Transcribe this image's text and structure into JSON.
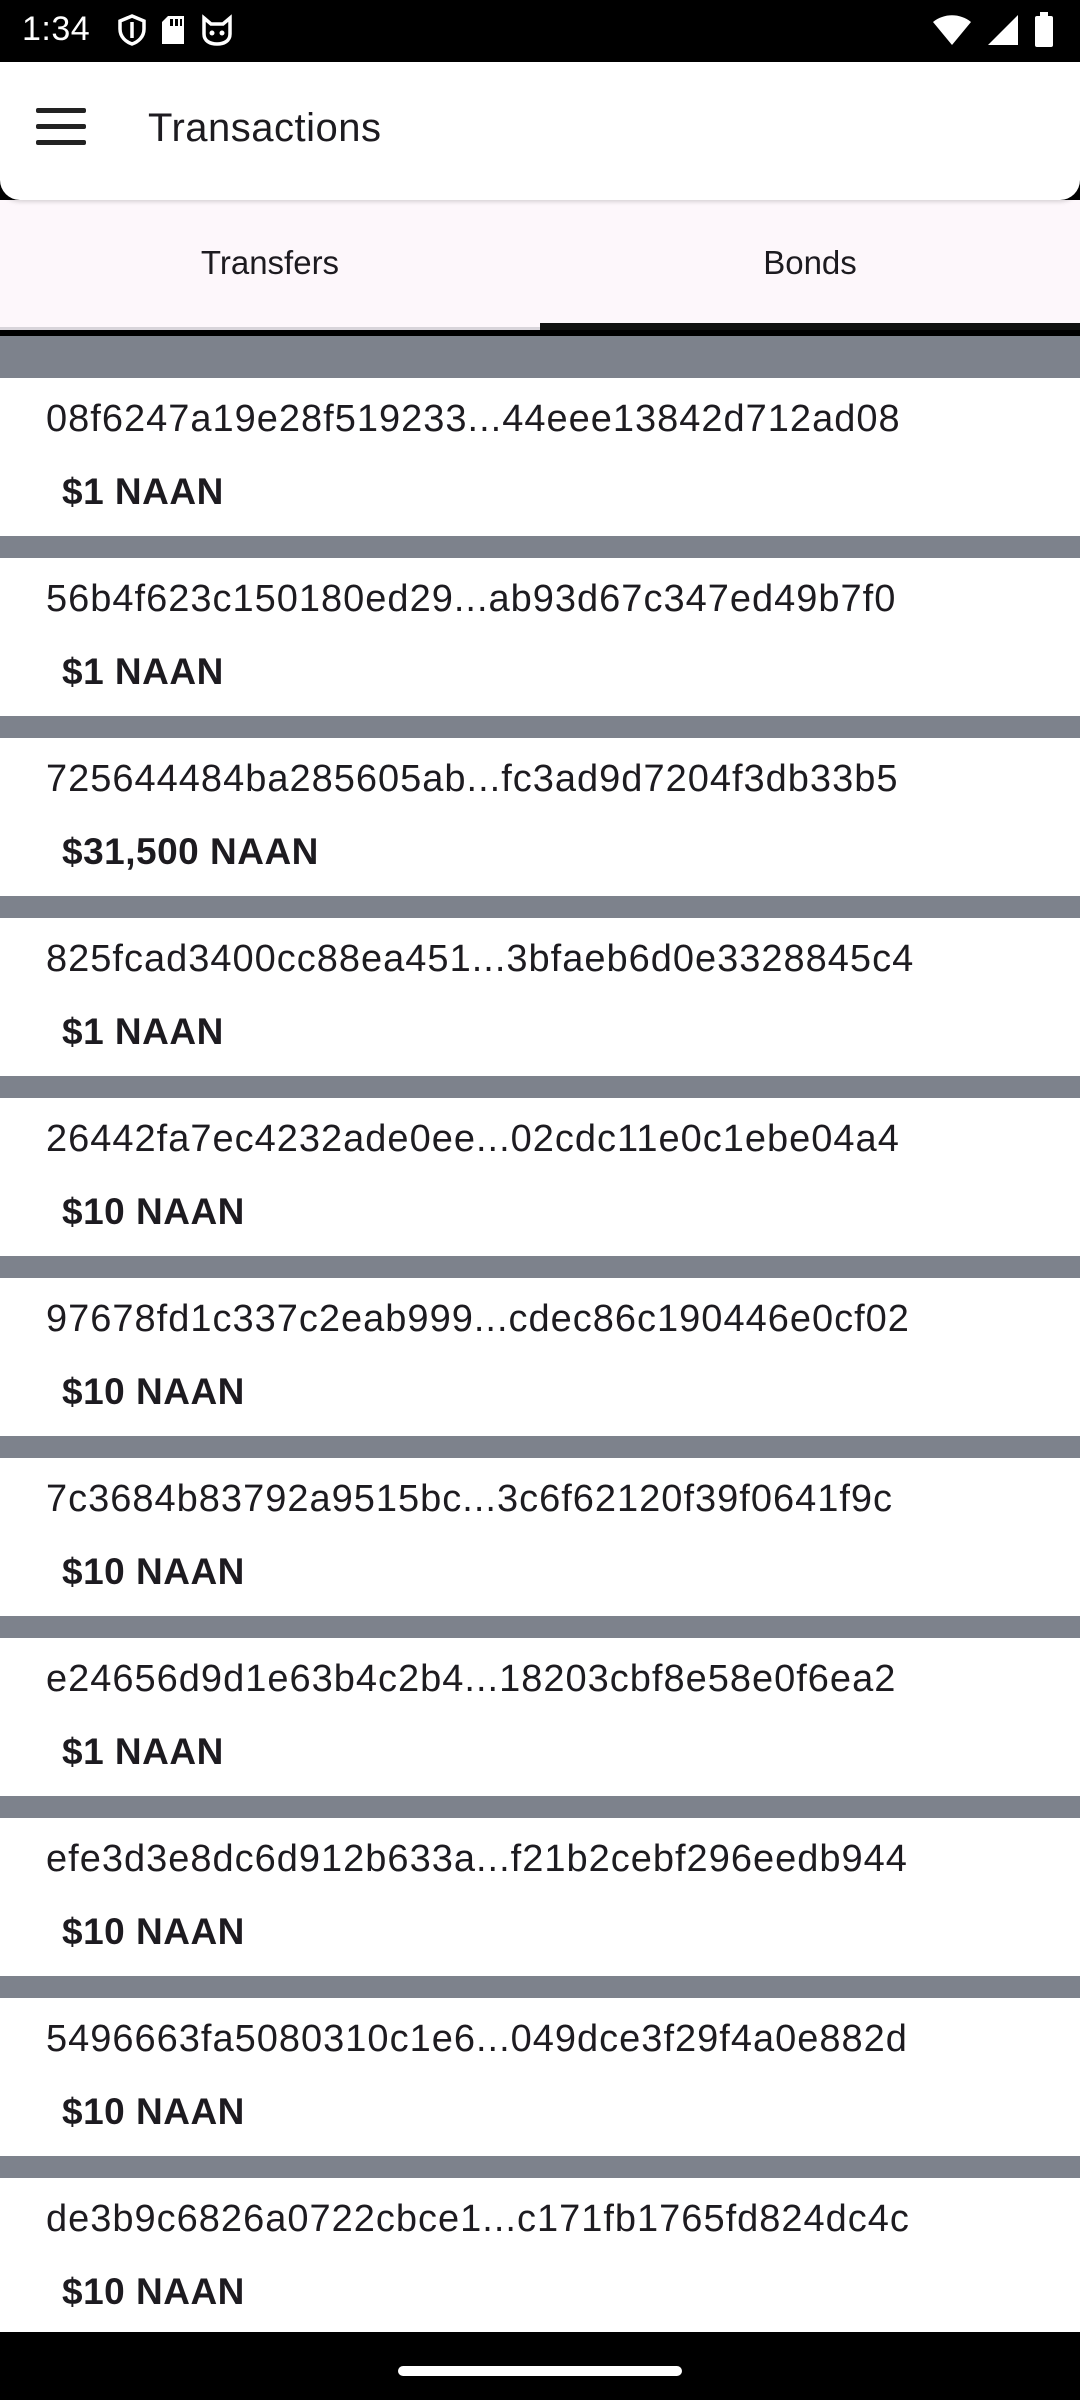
{
  "status_bar": {
    "time": "1:34",
    "left_icons": [
      "shield-icon",
      "sd-card-icon",
      "cat-face-icon"
    ],
    "right_icons": [
      "wifi-icon",
      "signal-icon",
      "battery-icon"
    ]
  },
  "app_bar": {
    "title": "Transactions",
    "menu_icon": "hamburger-menu-icon"
  },
  "tabs": [
    {
      "label": "Transfers",
      "selected": false
    },
    {
      "label": "Bonds",
      "selected": true
    }
  ],
  "bonds": [
    {
      "hash": "08f6247a19e28f519233...44eee13842d712ad08",
      "amount": "$1 NAAN"
    },
    {
      "hash": "56b4f623c150180ed29...ab93d67c347ed49b7f0",
      "amount": "$1 NAAN"
    },
    {
      "hash": "725644484ba285605ab...fc3ad9d7204f3db33b5",
      "amount": "$31,500 NAAN"
    },
    {
      "hash": "825fcad3400cc88ea451...3bfaeb6d0e3328845c4",
      "amount": "$1 NAAN"
    },
    {
      "hash": "26442fa7ec4232ade0ee...02cdc11e0c1ebe04a4",
      "amount": "$10 NAAN"
    },
    {
      "hash": "97678fd1c337c2eab999...cdec86c190446e0cf02",
      "amount": "$10 NAAN"
    },
    {
      "hash": "7c3684b83792a9515bc...3c6f62120f39f0641f9c",
      "amount": "$10 NAAN"
    },
    {
      "hash": "e24656d9d1e63b4c2b4...18203cbf8e58e0f6ea2",
      "amount": "$1 NAAN"
    },
    {
      "hash": "efe3d3e8dc6d912b633a...f21b2cebf296eedb944",
      "amount": "$10 NAAN"
    },
    {
      "hash": "5496663fa5080310c1e6...049dce3f29f4a0e882d",
      "amount": "$10 NAAN"
    },
    {
      "hash": "de3b9c6826a0722cbce1...c171fb1765fd824dc4c",
      "amount": "$10 NAAN"
    }
  ],
  "colors": {
    "list_background": "#7d828c",
    "tab_background": "#fdf7fb",
    "active_indicator": "#111111"
  }
}
